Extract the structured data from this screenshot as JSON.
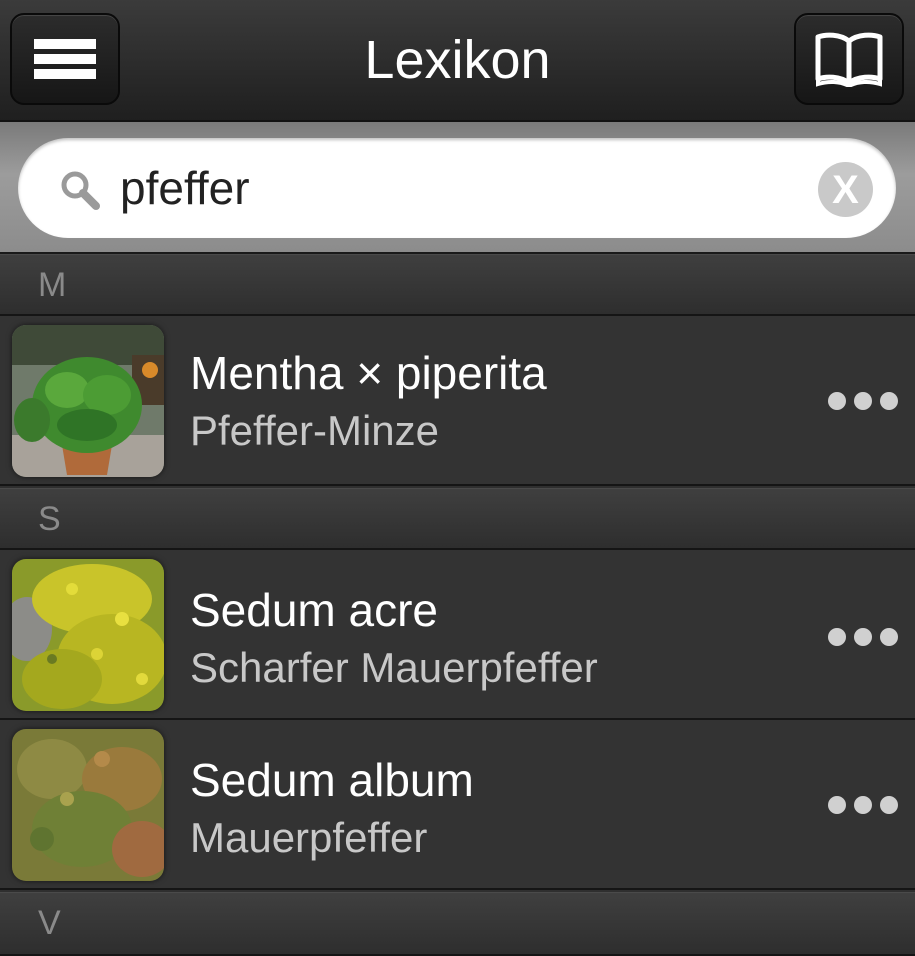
{
  "header": {
    "title": "Lexikon"
  },
  "search": {
    "query": "pfeffer",
    "clear_label": "X"
  },
  "sections": [
    {
      "letter": "M"
    },
    {
      "letter": "S"
    },
    {
      "letter": "V"
    }
  ],
  "entries": [
    {
      "latin_name": "Mentha × piperita",
      "common_name": "Pfeffer-Minze",
      "section": "M"
    },
    {
      "latin_name": "Sedum acre",
      "common_name": "Scharfer Mauerpfeffer",
      "section": "S"
    },
    {
      "latin_name": "Sedum album",
      "common_name": "Mauerpfeffer",
      "section": "S"
    }
  ],
  "icons": {
    "menu": "hamburger-icon",
    "book": "book-icon",
    "search": "magnifier-icon",
    "clear": "clear-icon",
    "more": "more-dots-icon"
  }
}
